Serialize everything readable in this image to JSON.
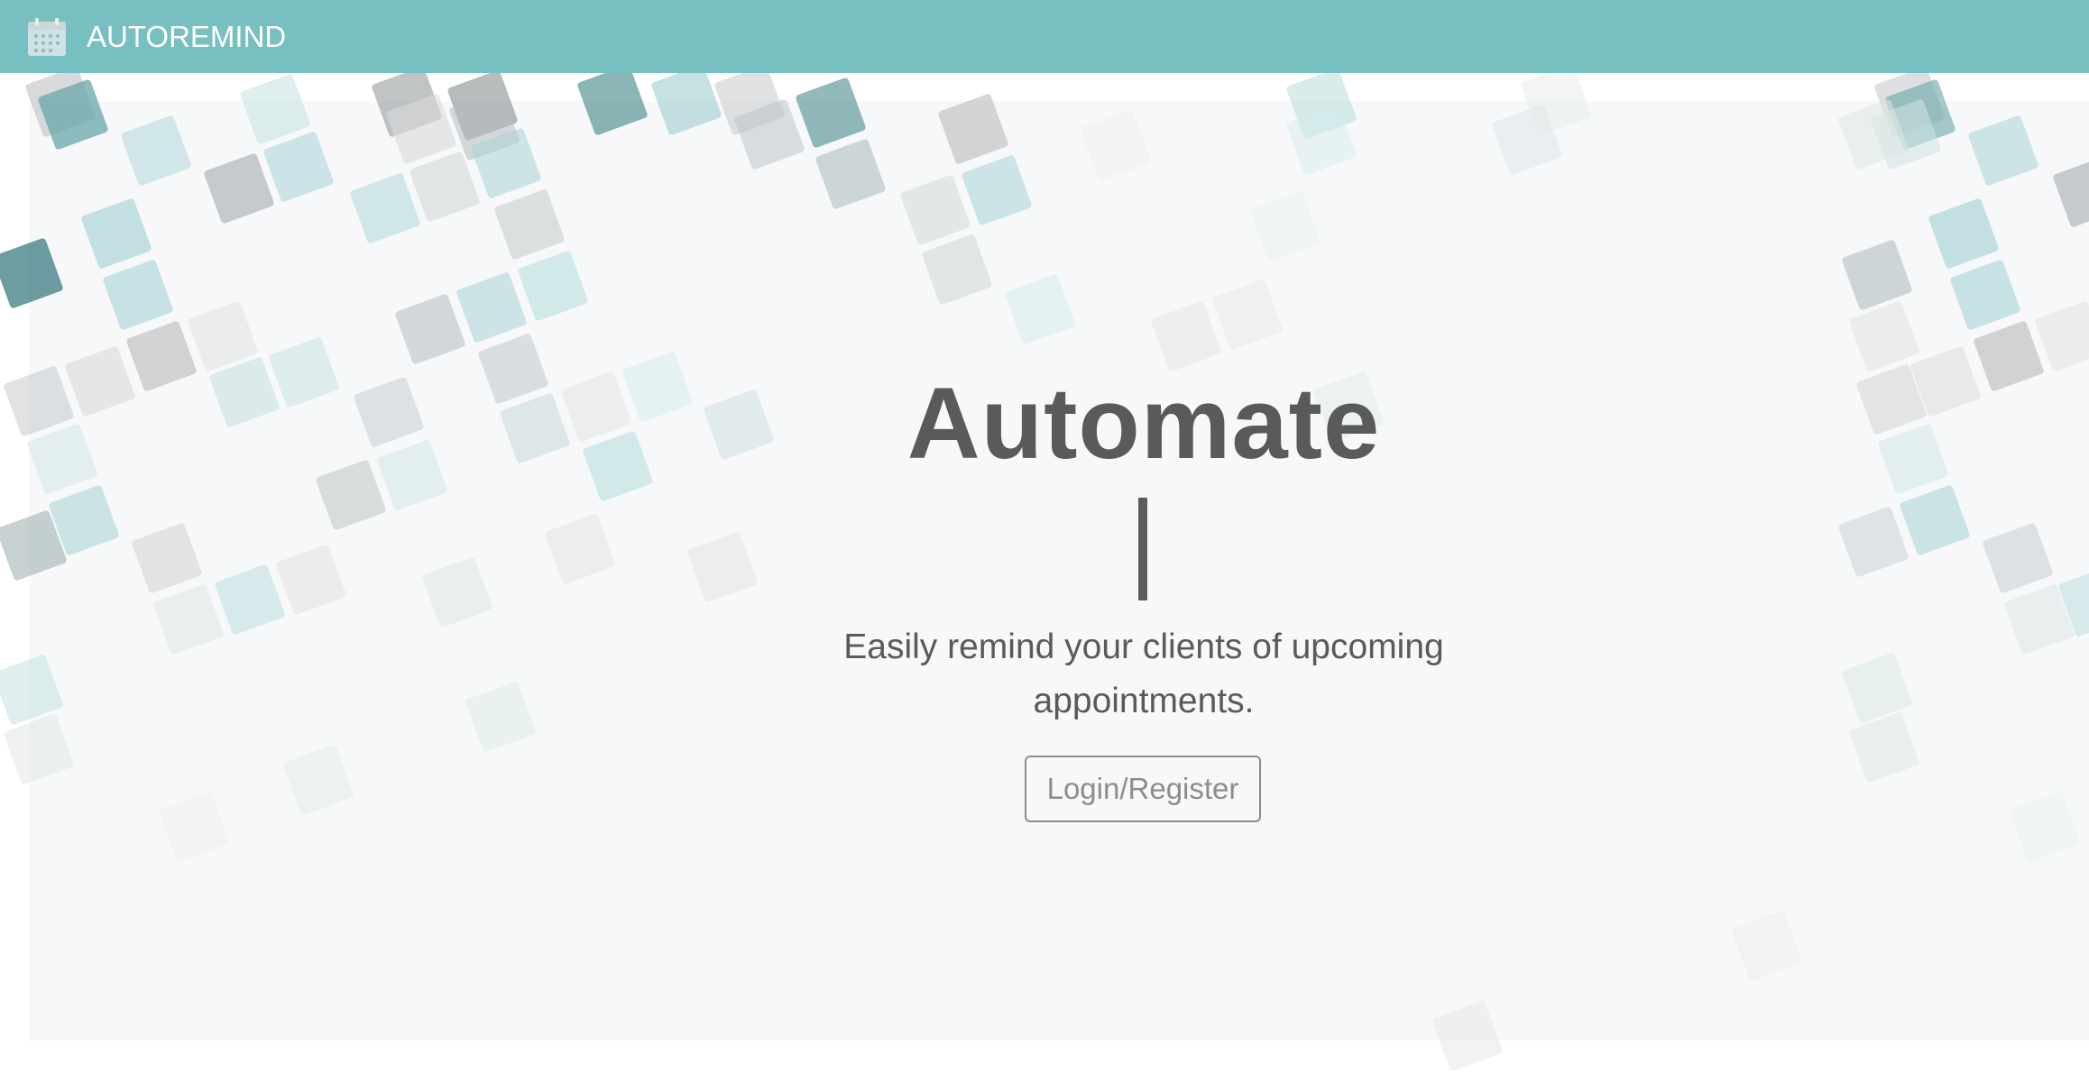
{
  "navbar": {
    "brand_icon": "calendar-icon",
    "brand_text": "AUTOREMIND",
    "background_color": "#78bfc1"
  },
  "hero": {
    "headline": "Automate",
    "subtitle": "Easily remind your clients of upcoming appointments.",
    "cta_label": "Login/Register",
    "text_color": "#595a5c",
    "background_color": "#f7f8fa"
  },
  "decoration": {
    "tile_colors": [
      "#3f8487",
      "#8fc7ca",
      "#b4b6b8",
      "#cfd8d6",
      "#e6e8e6"
    ]
  }
}
